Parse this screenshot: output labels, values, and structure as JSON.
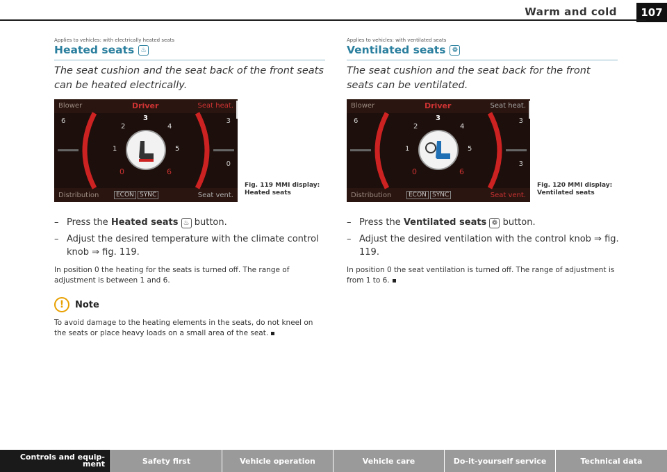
{
  "header": {
    "title": "Warm and cold",
    "page_number": "107"
  },
  "left": {
    "applies": "Applies to vehicles: with electrically heated seats",
    "title": "Heated seats",
    "intro": "The seat cushion and the seat back of the front seats can be heated electrically.",
    "display": {
      "top_left": "Blower",
      "top_center": "Driver",
      "top_right": "Seat heat.",
      "bottom_left": "Distribution",
      "bottom_right": "Seat vent.",
      "modes": [
        "ECON",
        "SYNC"
      ],
      "dial_numbers": [
        "3",
        "2",
        "4",
        "1",
        "5",
        "0",
        "6"
      ],
      "left_digit": "6",
      "right_top_digit": "3",
      "right_bottom_digit": "0"
    },
    "figure_caption_num": "Fig. 119",
    "figure_caption_title": "MMI display:",
    "figure_caption_sub": "Heated seats",
    "step1_pre": "Press the ",
    "step1_bold": "Heated seats",
    "step1_post": " button.",
    "step2": "Adjust the desired temperature with the climate control knob ⇒ fig. 119.",
    "para": "In position 0 the heating for the seats is turned off. The range of adjustment is between 1 and 6.",
    "note_label": "Note",
    "note_text": "To avoid damage to the heating elements in the seats, do not kneel on the seats or place heavy loads on a small area of the seat."
  },
  "right": {
    "applies": "Applies to vehicles: with ventilated seats",
    "title": "Ventilated seats",
    "intro": "The seat cushion and the seat back for the front seats can be ventilated.",
    "display": {
      "top_left": "Blower",
      "top_center": "Driver",
      "top_right": "Seat heat.",
      "bottom_left": "Distribution",
      "bottom_right": "Seat vent.",
      "modes": [
        "ECON",
        "SYNC"
      ],
      "dial_numbers": [
        "3",
        "2",
        "4",
        "1",
        "5",
        "0",
        "6"
      ],
      "left_digit": "6",
      "right_top_digit": "3",
      "right_bottom_digit": "3"
    },
    "figure_caption_num": "Fig. 120",
    "figure_caption_title": "MMI display:",
    "figure_caption_sub": "Ventilated seats",
    "step1_pre": "Press the ",
    "step1_bold": "Ventilated seats",
    "step1_post": " button.",
    "step2": "Adjust the desired ventilation with the control knob ⇒ fig. 119.",
    "para": "In position 0 the seat ventilation is turned off. The range of adjustment is from 1 to 6."
  },
  "footer": {
    "tabs": [
      "Controls and equip-ment",
      "Safety first",
      "Vehicle operation",
      "Vehicle care",
      "Do-it-yourself service",
      "Technical data"
    ]
  },
  "colors": {
    "accent": "#2a7f9e",
    "footer_active": "#1a1a1a",
    "footer_tab": "#9a9a9a",
    "display_red": "#cc2222"
  }
}
